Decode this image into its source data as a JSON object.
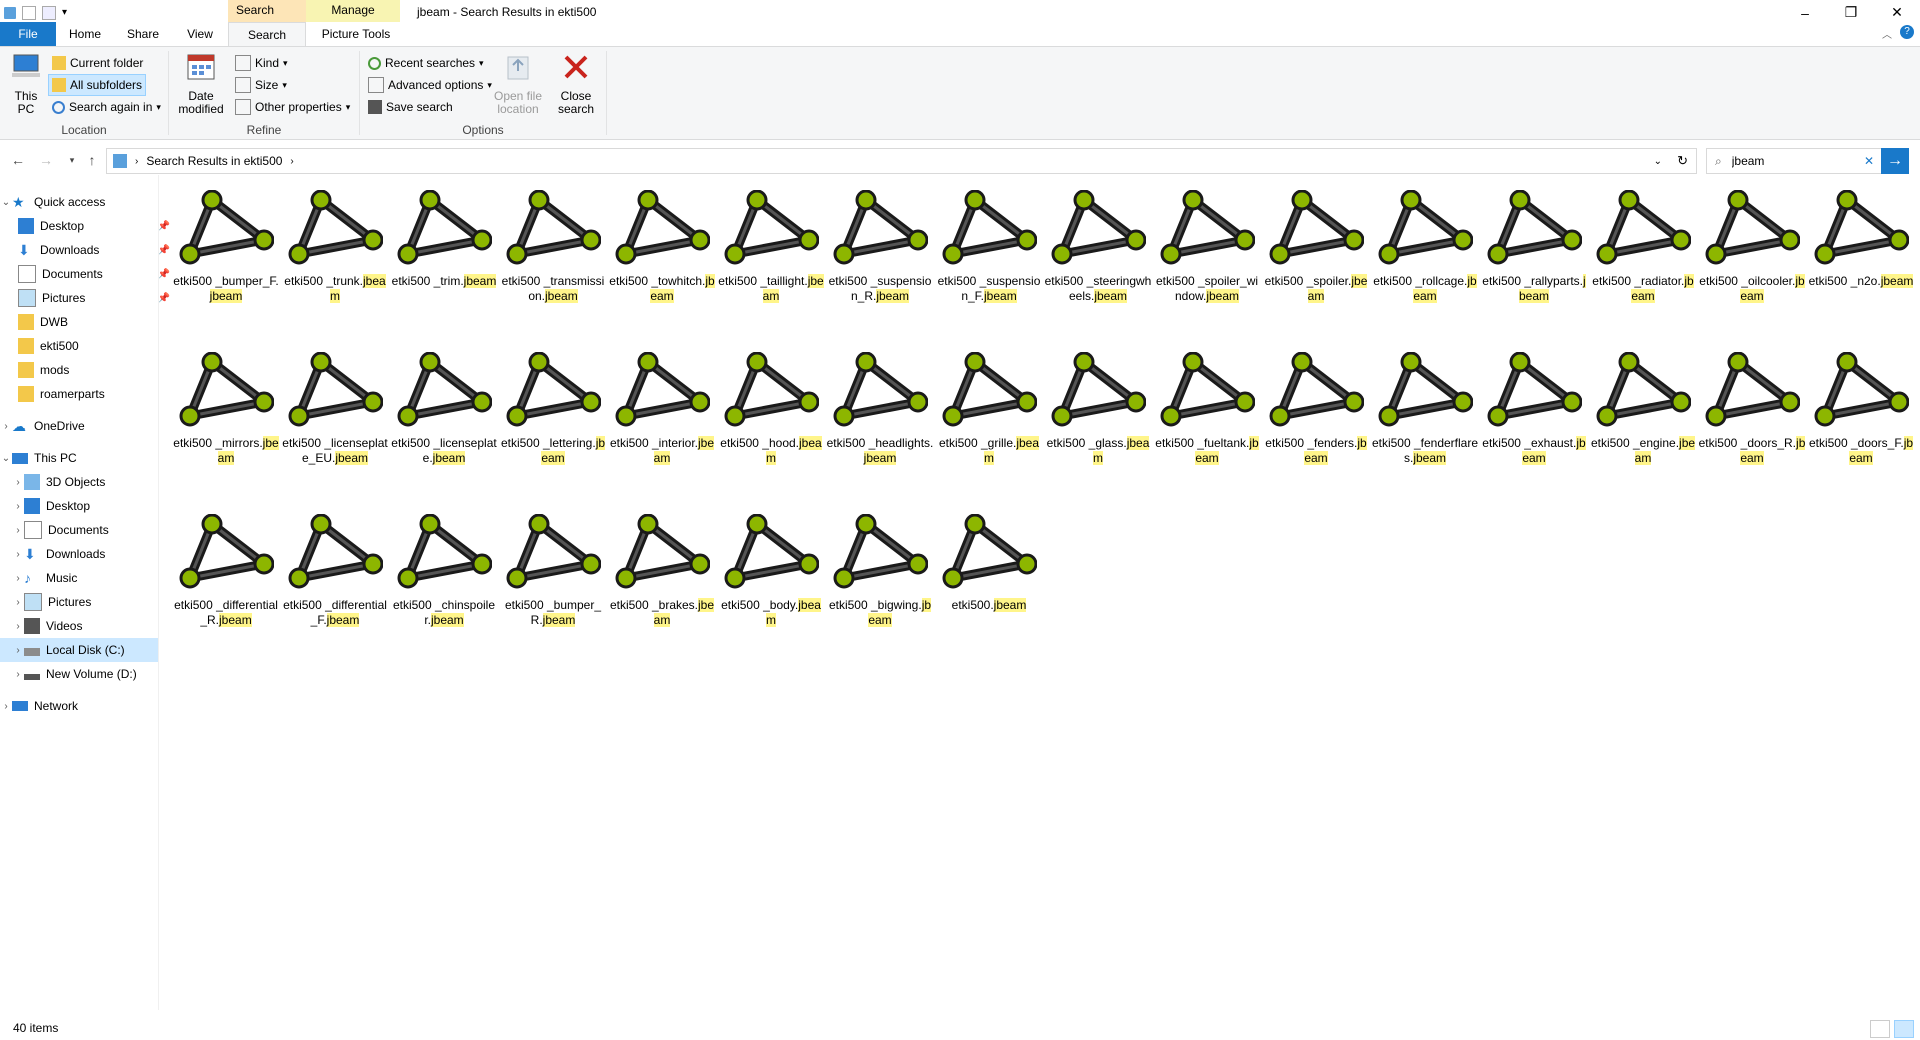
{
  "window": {
    "title": "jbeam - Search Results in ekti500",
    "context_tabs": [
      "Search Tools",
      "Manage"
    ],
    "context_subtabs": [
      "Search",
      "Picture Tools"
    ]
  },
  "ribbon_tabs": [
    "File",
    "Home",
    "Share",
    "View"
  ],
  "ribbon": {
    "location": {
      "label": "Location",
      "this_pc": "This PC",
      "current_folder": "Current folder",
      "all_subfolders": "All subfolders",
      "search_again_in": "Search again in"
    },
    "refine": {
      "label": "Refine",
      "date_modified": "Date modified",
      "kind": "Kind",
      "size": "Size",
      "other_properties": "Other properties"
    },
    "options": {
      "label": "Options",
      "recent_searches": "Recent searches",
      "advanced_options": "Advanced options",
      "save_search": "Save search",
      "open_file_location": "Open file location",
      "close_search": "Close search"
    }
  },
  "address": {
    "path": "Search Results in ekti500",
    "search_value": "jbeam"
  },
  "sidebar": {
    "quick_access": "Quick access",
    "quick_items": [
      "Desktop",
      "Downloads",
      "Documents",
      "Pictures",
      "DWB",
      "ekti500",
      "mods",
      "roamerparts"
    ],
    "onedrive": "OneDrive",
    "this_pc": "This PC",
    "pc_items": [
      "3D Objects",
      "Desktop",
      "Documents",
      "Downloads",
      "Music",
      "Pictures",
      "Videos",
      "Local Disk (C:)",
      "New Volume (D:)"
    ],
    "network": "Network"
  },
  "files": [
    {
      "pre": "etki500 _bumper_F.",
      "hl": "jbeam"
    },
    {
      "pre": "etki500 _trunk.",
      "hl": "jbeam"
    },
    {
      "pre": "etki500 _trim.",
      "hl": "jbeam"
    },
    {
      "pre": "etki500 _transmission.",
      "hl": "jbeam"
    },
    {
      "pre": "etki500 _towhitch.",
      "hl": "jbeam"
    },
    {
      "pre": "etki500 _taillight.",
      "hl": "jbeam"
    },
    {
      "pre": "etki500 _suspension_R.",
      "hl": "jbeam"
    },
    {
      "pre": "etki500 _suspension_F.",
      "hl": "jbeam"
    },
    {
      "pre": "etki500 _steeringwheels.",
      "hl": "jbeam"
    },
    {
      "pre": "etki500 _spoiler_window.",
      "hl": "jbeam"
    },
    {
      "pre": "etki500 _spoiler.",
      "hl": "jbeam"
    },
    {
      "pre": "etki500 _rollcage.",
      "hl": "jbeam"
    },
    {
      "pre": "etki500 _rallyparts.",
      "hl": "jbeam"
    },
    {
      "pre": "etki500 _radiator.",
      "hl": "jbeam"
    },
    {
      "pre": "etki500 _oilcooler.",
      "hl": "jbeam"
    },
    {
      "pre": "etki500 _n2o.",
      "hl": "jbeam"
    },
    {
      "pre": "etki500 _mirrors.",
      "hl": "jbeam"
    },
    {
      "pre": "etki500 _licenseplate_EU.",
      "hl": "jbeam"
    },
    {
      "pre": "etki500 _licenseplate.",
      "hl": "jbeam"
    },
    {
      "pre": "etki500 _lettering.",
      "hl": "jbeam"
    },
    {
      "pre": "etki500 _interior.",
      "hl": "jbeam"
    },
    {
      "pre": "etki500 _hood.",
      "hl": "jbeam"
    },
    {
      "pre": "etki500 _headlights.",
      "hl": "jbeam"
    },
    {
      "pre": "etki500 _grille.",
      "hl": "jbeam"
    },
    {
      "pre": "etki500 _glass.",
      "hl": "jbeam"
    },
    {
      "pre": "etki500 _fueltank.",
      "hl": "jbeam"
    },
    {
      "pre": "etki500 _fenders.",
      "hl": "jbeam"
    },
    {
      "pre": "etki500 _fenderflares.",
      "hl": "jbeam"
    },
    {
      "pre": "etki500 _exhaust.",
      "hl": "jbeam"
    },
    {
      "pre": "etki500 _engine.",
      "hl": "jbeam"
    },
    {
      "pre": "etki500 _doors_R.",
      "hl": "jbeam"
    },
    {
      "pre": "etki500 _doors_F.",
      "hl": "jbeam"
    },
    {
      "pre": "etki500 _differential_R.",
      "hl": "jbeam"
    },
    {
      "pre": "etki500 _differential_F.",
      "hl": "jbeam"
    },
    {
      "pre": "etki500 _chinspoiler.",
      "hl": "jbeam"
    },
    {
      "pre": "etki500 _bumper_R.",
      "hl": "jbeam"
    },
    {
      "pre": "etki500 _brakes.",
      "hl": "jbeam"
    },
    {
      "pre": "etki500 _body.",
      "hl": "jbeam"
    },
    {
      "pre": "etki500 _bigwing.",
      "hl": "jbeam"
    },
    {
      "pre": "etki500.",
      "hl": "jbeam"
    }
  ],
  "status": {
    "item_count": "40 items"
  },
  "colors": {
    "accent": "#1979ca",
    "selection": "#cce8ff",
    "highlight": "#fff58a",
    "icon_node": "#8db600"
  }
}
